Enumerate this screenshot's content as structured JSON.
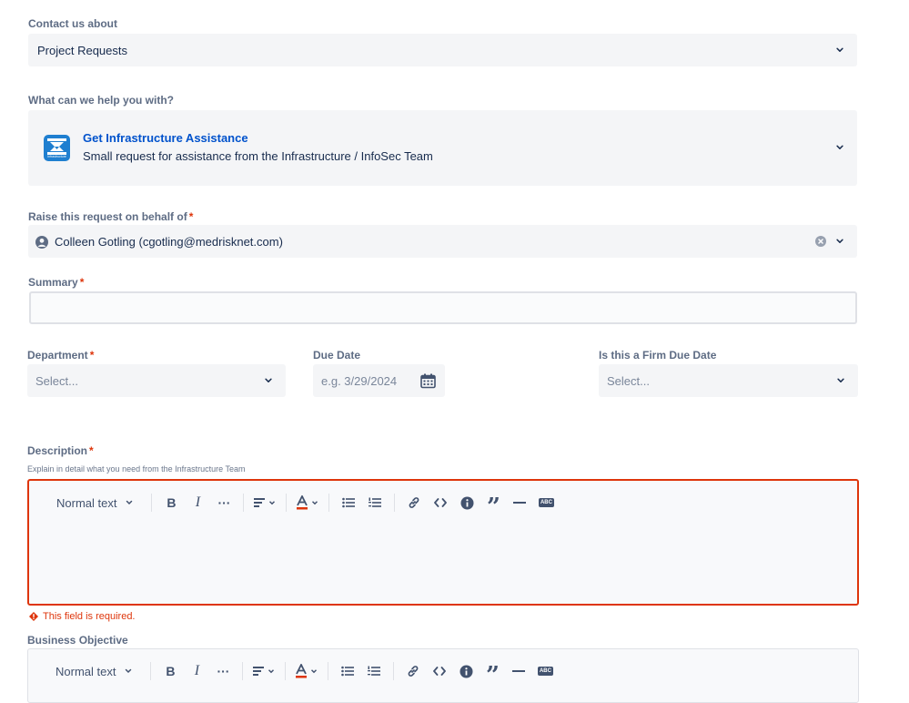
{
  "contact": {
    "label": "Contact us about",
    "value": "Project Requests"
  },
  "help": {
    "label": "What can we help you with?",
    "title": "Get Infrastructure Assistance",
    "description": "Small request for assistance from the Infrastructure / InfoSec Team",
    "icon_caption": "Infrastructure"
  },
  "behalf": {
    "label": "Raise this request on behalf of",
    "required": "*",
    "value": "Colleen Gotling (cgotling@medrisknet.com)"
  },
  "summary": {
    "label": "Summary",
    "required": "*",
    "value": ""
  },
  "department": {
    "label": "Department",
    "required": "*",
    "placeholder": "Select..."
  },
  "due_date": {
    "label": "Due Date",
    "placeholder": "e.g. 3/29/2024"
  },
  "firm_due": {
    "label": "Is this a Firm Due Date",
    "placeholder": "Select..."
  },
  "description": {
    "label": "Description",
    "required": "*",
    "helper": "Explain in detail what you need from the Infrastructure Team",
    "error": "This field is required."
  },
  "business_objective": {
    "label": "Business Objective"
  },
  "toolbar": {
    "text_style": "Normal text",
    "bold": "B",
    "italic": "I",
    "more": "···",
    "quote": "”",
    "abc": "ABC"
  },
  "colors": {
    "link": "#0052cc",
    "error": "#de350b",
    "field_bg": "#f4f5f7"
  }
}
